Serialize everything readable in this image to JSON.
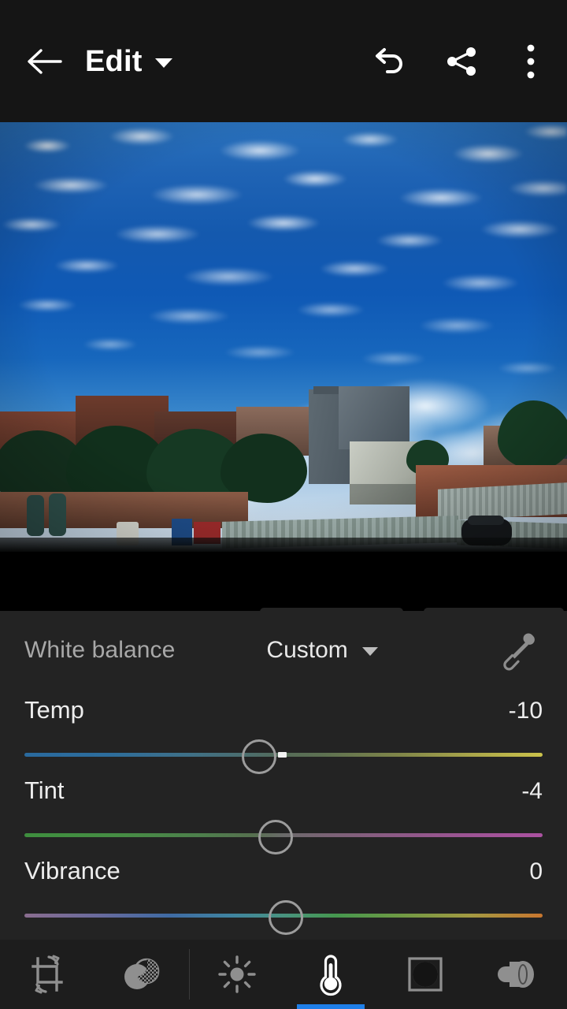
{
  "topbar": {
    "back_label": "back-arrow",
    "title": "Edit",
    "caret": "chevron-down",
    "undo_label": "Undo",
    "share_label": "Share",
    "menu_label": "More options"
  },
  "photo": {
    "description": "Rooftop cityscape under a blue sky with altocumulus and cumulus clouds"
  },
  "panel": {
    "white_balance": {
      "label": "White balance",
      "value": "Custom",
      "eyedropper_label": "eyedropper"
    },
    "sliders": [
      {
        "name": "Temp",
        "value": "-10",
        "knob_percent": 44.8,
        "tick_percent": 49.0,
        "show_tick": true,
        "gradient": "blue-to-yellow"
      },
      {
        "name": "Tint",
        "value": "-4",
        "knob_percent": 48.1,
        "tick_percent": 50.0,
        "show_tick": false,
        "gradient": "green-to-magenta"
      },
      {
        "name": "Vibrance",
        "value": "0",
        "knob_percent": 50.0,
        "tick_percent": 50.0,
        "show_tick": false,
        "gradient": "purple-blue-green-orange"
      }
    ]
  },
  "bottombar": {
    "active_index": 3,
    "accent_color": "#1f7fe8",
    "items": [
      {
        "icon": "crop-rotate-icon",
        "label": "Crop",
        "active": false
      },
      {
        "icon": "presets-icon",
        "label": "Presets",
        "active": false
      },
      {
        "icon": "light-sun-icon",
        "label": "Light",
        "active": false
      },
      {
        "icon": "color-thermometer-icon",
        "label": "Color",
        "active": true
      },
      {
        "icon": "effects-vignette-icon",
        "label": "Effects",
        "active": false
      },
      {
        "icon": "detail-lens-icon",
        "label": "Detail",
        "active": false
      }
    ]
  }
}
